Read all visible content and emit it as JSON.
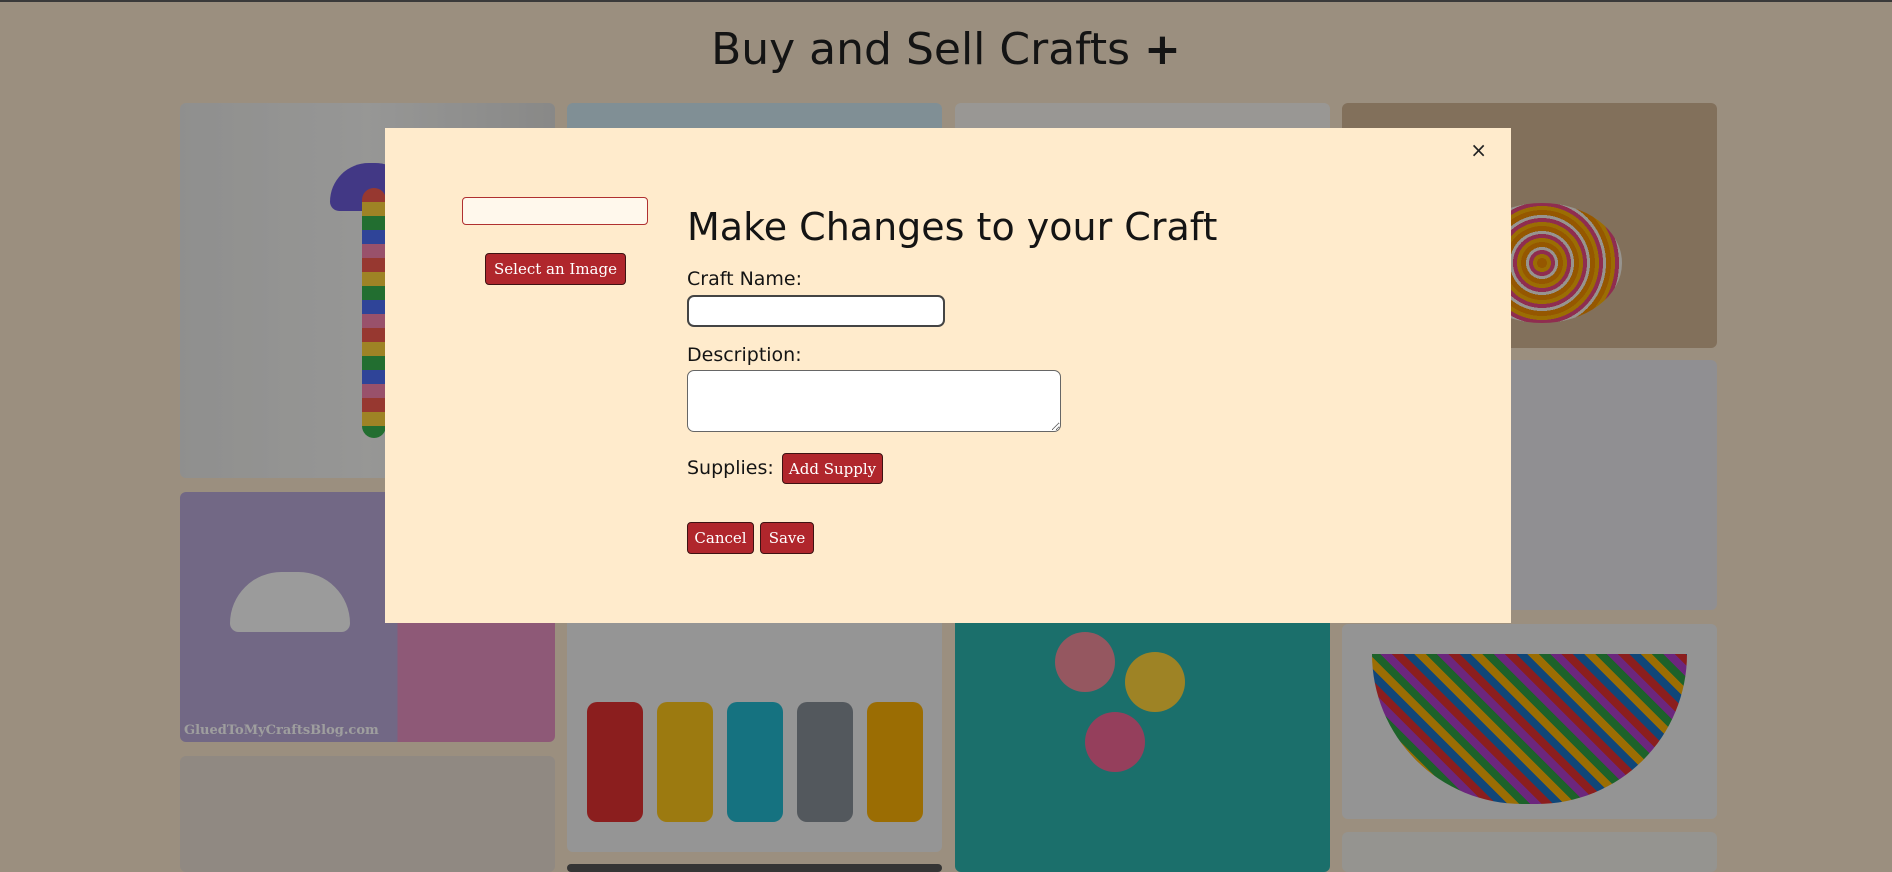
{
  "header": {
    "title": "Buy and Sell Crafts",
    "add_icon": "+"
  },
  "gallery": {
    "tile_caption": "GluedToMyCraftsBlog.com"
  },
  "modal": {
    "close_icon": "×",
    "image_name_value": "",
    "select_image_label": "Select an Image",
    "heading": "Make Changes to your Craft",
    "craft_name_label": "Craft Name:",
    "craft_name_value": "",
    "description_label": "Description:",
    "description_value": "",
    "supplies_label": "Supplies:",
    "add_supply_label": "Add Supply",
    "cancel_label": "Cancel",
    "save_label": "Save"
  },
  "colors": {
    "page_bg": "#9b8f7f",
    "modal_bg": "#ffebcc",
    "button_bg": "#b0262c"
  }
}
